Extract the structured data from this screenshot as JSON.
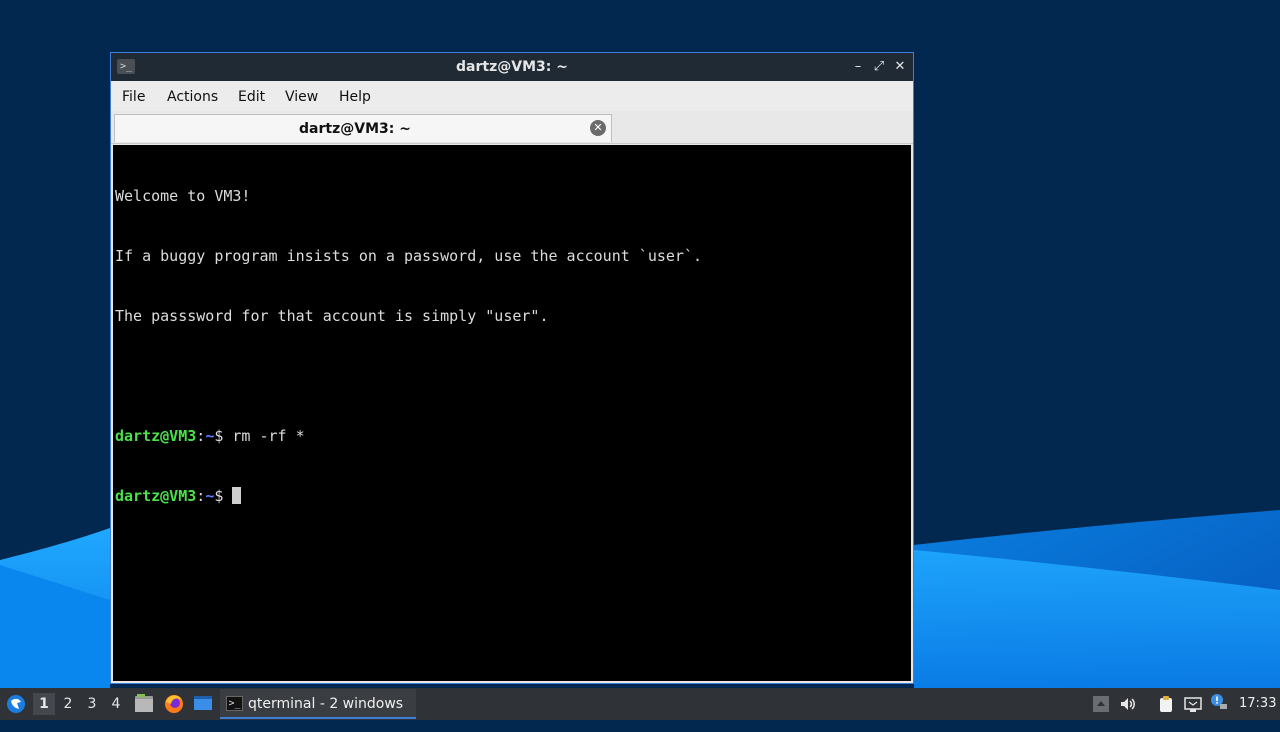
{
  "window": {
    "title": "dartz@VM3: ~",
    "title_icon": ">_",
    "controls": {
      "minimize": "–",
      "maximize": "⤢",
      "close": "✕"
    }
  },
  "menubar": {
    "items": [
      "File",
      "Actions",
      "Edit",
      "View",
      "Help"
    ]
  },
  "tab": {
    "label": "dartz@VM3: ~",
    "close_icon": "✕"
  },
  "terminal": {
    "lines": [
      "Welcome to VM3!",
      "If a buggy program insists on a password, use the account `user`.",
      "The passsword for that account is simply \"user\"."
    ],
    "prompt": {
      "user_host": "dartz@VM3",
      "sep": ":",
      "dir": "~",
      "symbol": "$ "
    },
    "commands": [
      "rm -rf *",
      ""
    ]
  },
  "taskbar": {
    "start_icon": "start-menu-icon",
    "workspaces": [
      "1",
      "2",
      "3",
      "4"
    ],
    "launchers": [
      "file-manager-icon",
      "firefox-icon",
      "show-desktop-icon"
    ],
    "task": {
      "icon": ">_",
      "label": "qterminal - 2 windows"
    },
    "tray": [
      "up-arrow-icon",
      "volume-icon",
      "clipboard-icon",
      "network-icon",
      "notification-icon"
    ],
    "clock": "17:33"
  },
  "colors": {
    "desktop_bg": "#02284f",
    "accent": "#3d7fd6",
    "prompt_user": "#4ce04c",
    "prompt_dir": "#5a7cff"
  }
}
